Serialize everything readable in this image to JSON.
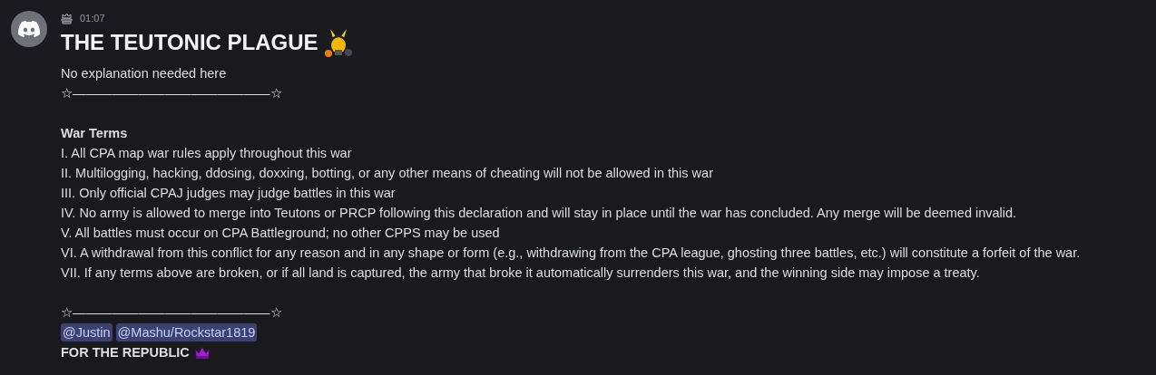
{
  "message": {
    "time": "01:07",
    "title": "THE TEUTONIC PLAGUE",
    "sections": [
      [
        {
          "kind": "text",
          "text": "No explanation needed here"
        },
        {
          "kind": "text",
          "text": "☆———————————————☆"
        }
      ],
      [
        {
          "kind": "bold",
          "text": "War Terms"
        },
        {
          "kind": "text",
          "text": "I. All CPA map war rules apply throughout this war"
        },
        {
          "kind": "text",
          "text": "II. Multilogging, hacking, ddosing, doxxing, botting, or any other means of cheating will not be allowed in this war"
        },
        {
          "kind": "text",
          "text": "III. Only official CPAJ judges may judge battles in this war"
        },
        {
          "kind": "text",
          "text": "IV. No army is allowed to merge into Teutons or PRCP following this declaration and will stay in place until the war has concluded. Any merge will be deemed invalid."
        },
        {
          "kind": "text",
          "text": "V. All battles must occur on CPA Battleground; no other CPPS may be used"
        },
        {
          "kind": "text",
          "text": "VI. A withdrawal from this conflict for any reason and in any shape or form (e.g., withdrawing from the CPA league, ghosting three battles, etc.) will constitute a forfeit of the war."
        },
        {
          "kind": "text",
          "text": "VII. If any terms above are broken, or if all land is captured, the army that broke it automatically surrenders this war, and the winning side may impose a treaty."
        }
      ],
      [
        {
          "kind": "text",
          "text": "☆———————————————☆"
        },
        {
          "kind": "mentions",
          "mentions": [
            "@Justin",
            "@Mashu/Rockstar1819"
          ]
        },
        {
          "kind": "banner",
          "text": "FOR THE REPUBLIC"
        }
      ]
    ]
  }
}
